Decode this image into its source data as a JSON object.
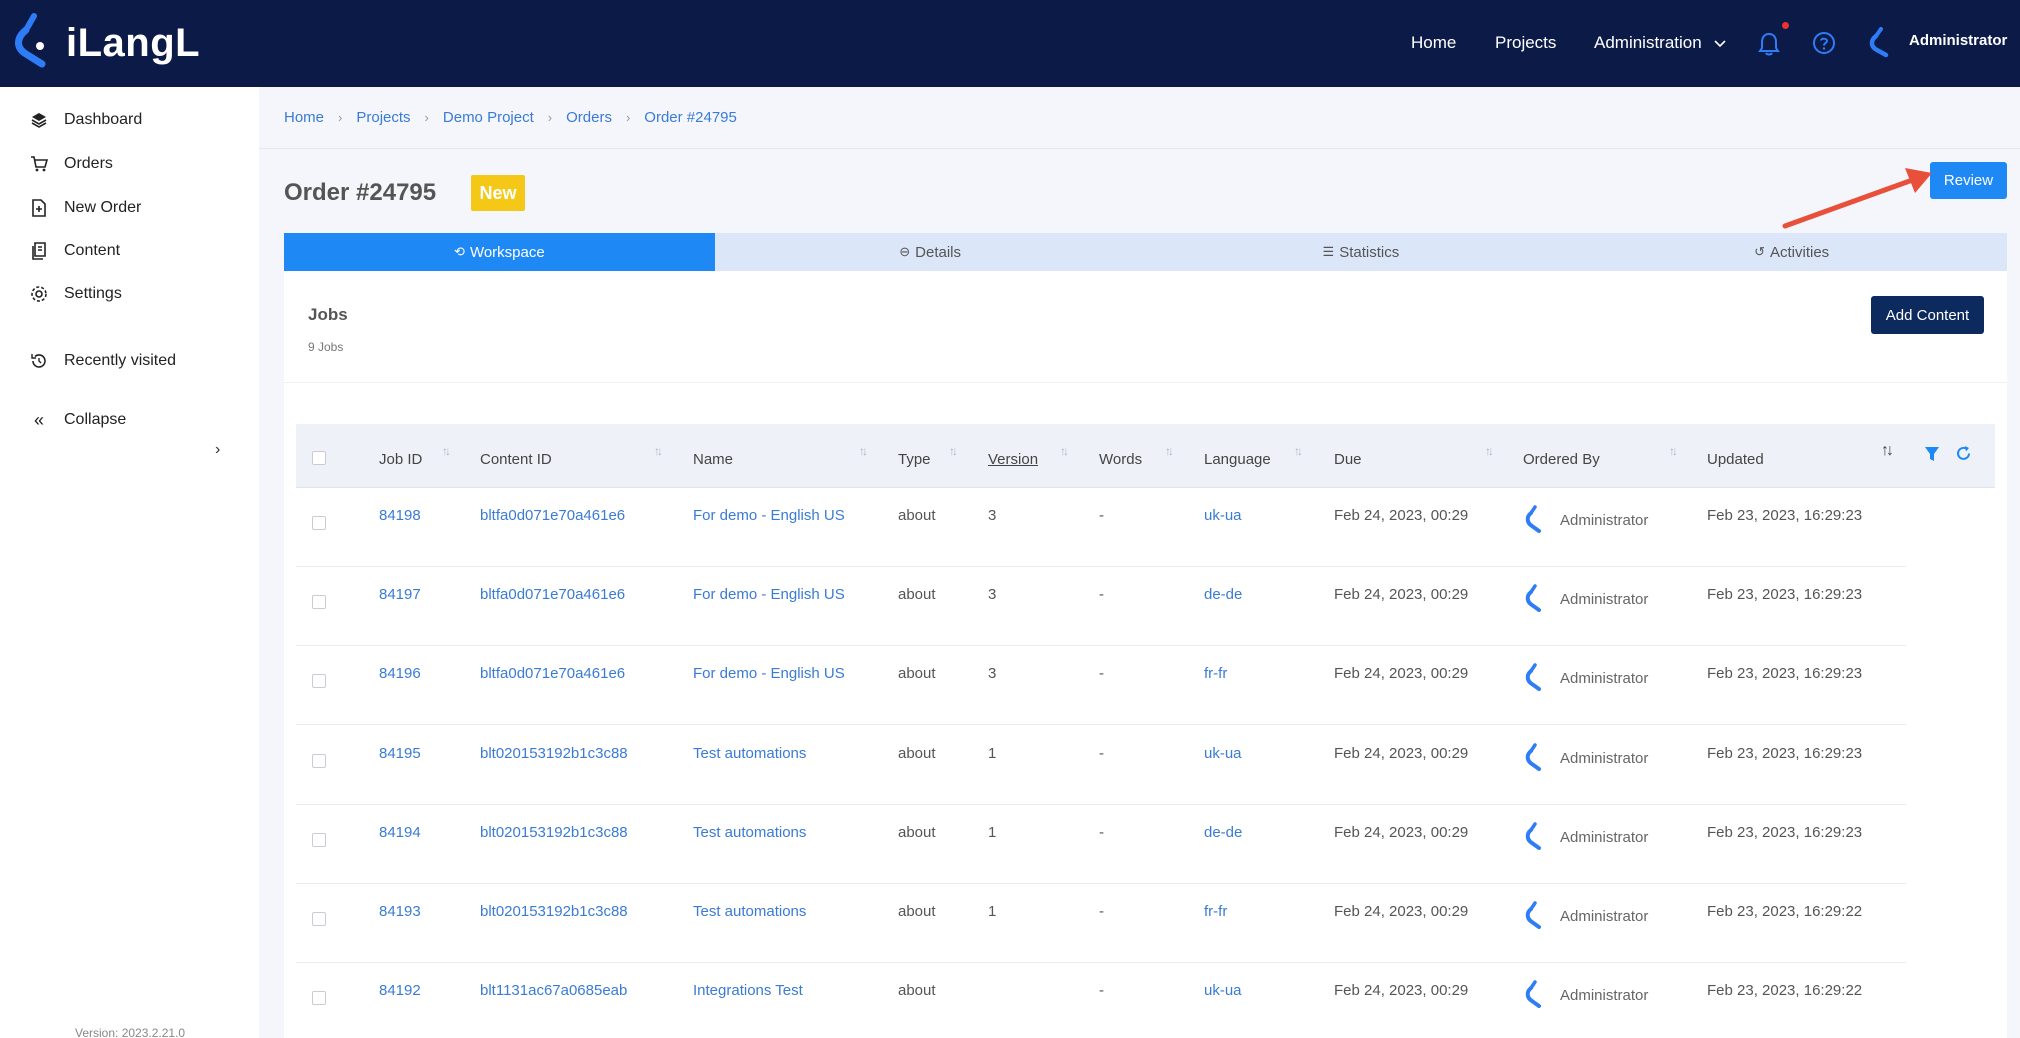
{
  "app": {
    "name": "iLangL"
  },
  "topnav": {
    "home": "Home",
    "projects": "Projects",
    "administration": "Administration",
    "user": "Administrator"
  },
  "sidebar": {
    "items": [
      {
        "label": "Dashboard",
        "icon": "layers-icon"
      },
      {
        "label": "Orders",
        "icon": "cart-icon"
      },
      {
        "label": "New Order",
        "icon": "file-plus-icon"
      },
      {
        "label": "Content",
        "icon": "documents-icon"
      },
      {
        "label": "Settings",
        "icon": "gear-icon"
      }
    ],
    "recently_visited": "Recently visited",
    "collapse": "Collapse",
    "version": "Version: 2023.2.21.0"
  },
  "breadcrumb": [
    "Home",
    "Projects",
    "Demo Project",
    "Orders",
    "Order #24795"
  ],
  "header": {
    "title": "Order #24795",
    "status": "New",
    "review_button": "Review"
  },
  "tabs": [
    {
      "label": "Workspace",
      "icon": "workspace-icon",
      "active": true
    },
    {
      "label": "Details",
      "icon": "minus-circle-icon",
      "active": false
    },
    {
      "label": "Statistics",
      "icon": "statistics-icon",
      "active": false
    },
    {
      "label": "Activities",
      "icon": "history-icon",
      "active": false
    }
  ],
  "jobs": {
    "title": "Jobs",
    "count": "9 Jobs",
    "add_content": "Add Content",
    "columns": [
      "Job ID",
      "Content ID",
      "Name",
      "Type",
      "Version",
      "Words",
      "Language",
      "Due",
      "Ordered By",
      "Updated"
    ],
    "rows": [
      {
        "job_id": "84198",
        "content_id": "bltfa0d071e70a461e6",
        "name": "For demo - English US",
        "type": "about",
        "version": "3",
        "words": "-",
        "language": "uk-ua",
        "due": "Feb 24, 2023, 00:29",
        "ordered_by": "Administrator",
        "updated": "Feb 23, 2023, 16:29:23"
      },
      {
        "job_id": "84197",
        "content_id": "bltfa0d071e70a461e6",
        "name": "For demo - English US",
        "type": "about",
        "version": "3",
        "words": "-",
        "language": "de-de",
        "due": "Feb 24, 2023, 00:29",
        "ordered_by": "Administrator",
        "updated": "Feb 23, 2023, 16:29:23"
      },
      {
        "job_id": "84196",
        "content_id": "bltfa0d071e70a461e6",
        "name": "For demo - English US",
        "type": "about",
        "version": "3",
        "words": "-",
        "language": "fr-fr",
        "due": "Feb 24, 2023, 00:29",
        "ordered_by": "Administrator",
        "updated": "Feb 23, 2023, 16:29:23"
      },
      {
        "job_id": "84195",
        "content_id": "blt020153192b1c3c88",
        "name": "Test automations",
        "type": "about",
        "version": "1",
        "words": "-",
        "language": "uk-ua",
        "due": "Feb 24, 2023, 00:29",
        "ordered_by": "Administrator",
        "updated": "Feb 23, 2023, 16:29:23"
      },
      {
        "job_id": "84194",
        "content_id": "blt020153192b1c3c88",
        "name": "Test automations",
        "type": "about",
        "version": "1",
        "words": "-",
        "language": "de-de",
        "due": "Feb 24, 2023, 00:29",
        "ordered_by": "Administrator",
        "updated": "Feb 23, 2023, 16:29:23"
      },
      {
        "job_id": "84193",
        "content_id": "blt020153192b1c3c88",
        "name": "Test automations",
        "type": "about",
        "version": "1",
        "words": "-",
        "language": "fr-fr",
        "due": "Feb 24, 2023, 00:29",
        "ordered_by": "Administrator",
        "updated": "Feb 23, 2023, 16:29:22"
      },
      {
        "job_id": "84192",
        "content_id": "blt1131ac67a0685eab",
        "name": "Integrations Test",
        "type": "about",
        "version": "",
        "words": "-",
        "language": "uk-ua",
        "due": "Feb 24, 2023, 00:29",
        "ordered_by": "Administrator",
        "updated": "Feb 23, 2023, 16:29:22"
      }
    ]
  },
  "colors": {
    "topbar": "#0c1a47",
    "accent": "#1e88f5",
    "badge_new": "#f5c818",
    "link": "#3a7bd5",
    "annotation_arrow": "#e8503a"
  }
}
